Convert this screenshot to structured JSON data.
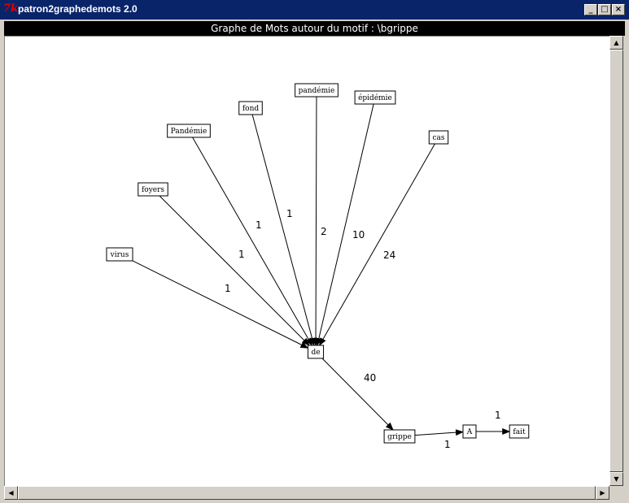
{
  "window": {
    "title": "patron2graphedemots 2.0",
    "icon": "tk-feather-icon",
    "minimize": "_",
    "maximize": "□",
    "close": "×"
  },
  "header": {
    "text": "Graphe de Mots autour du motif : \\bgrippe"
  },
  "graph": {
    "nodes": [
      {
        "id": "virus",
        "label": "virus"
      },
      {
        "id": "foyers",
        "label": "foyers"
      },
      {
        "id": "Pandemie",
        "label": "Pandémie"
      },
      {
        "id": "fond",
        "label": "fond"
      },
      {
        "id": "pandemie",
        "label": "pandémie"
      },
      {
        "id": "epidemie",
        "label": "épidémie"
      },
      {
        "id": "cas",
        "label": "cas"
      },
      {
        "id": "de",
        "label": "de"
      },
      {
        "id": "grippe",
        "label": "grippe"
      },
      {
        "id": "A",
        "label": "A"
      },
      {
        "id": "fait",
        "label": "fait"
      }
    ],
    "edges": [
      {
        "from": "virus",
        "to": "de",
        "label": "1"
      },
      {
        "from": "foyers",
        "to": "de",
        "label": "1"
      },
      {
        "from": "Pandemie",
        "to": "de",
        "label": "1"
      },
      {
        "from": "fond",
        "to": "de",
        "label": "1"
      },
      {
        "from": "pandemie",
        "to": "de",
        "label": "2"
      },
      {
        "from": "epidemie",
        "to": "de",
        "label": "10"
      },
      {
        "from": "cas",
        "to": "de",
        "label": "24"
      },
      {
        "from": "de",
        "to": "grippe",
        "label": "40"
      },
      {
        "from": "grippe",
        "to": "A",
        "label": "1"
      },
      {
        "from": "A",
        "to": "fait",
        "label": "1"
      }
    ]
  },
  "scrollbars": {
    "up": "▲",
    "down": "▼",
    "left": "◀",
    "right": "▶"
  }
}
